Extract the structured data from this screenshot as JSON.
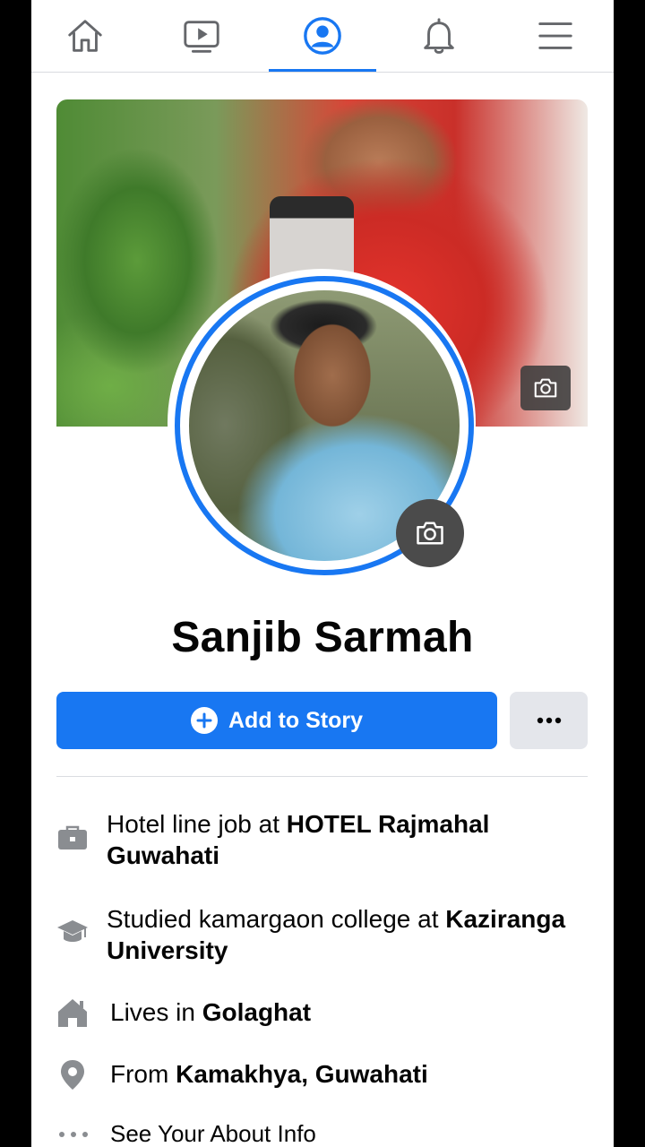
{
  "nav": {
    "tabs": [
      {
        "name": "home",
        "icon": "home-icon"
      },
      {
        "name": "watch",
        "icon": "video-icon"
      },
      {
        "name": "profile",
        "icon": "profile-icon",
        "active": true
      },
      {
        "name": "notifications",
        "icon": "bell-icon"
      },
      {
        "name": "menu",
        "icon": "hamburger-menu-icon"
      }
    ],
    "accent_color": "#1877f2"
  },
  "profile": {
    "name": "Sanjib Sarmah"
  },
  "actions": {
    "add_story_label": "Add to Story",
    "more_label": "•••"
  },
  "details": {
    "work_prefix": "Hotel line job at ",
    "work_place": "HOTEL Rajmahal Guwahati",
    "education_prefix": "Studied kamargaon college at ",
    "education_place": "Kaziranga University",
    "lives_prefix": "Lives in ",
    "lives_place": "Golaghat",
    "from_prefix": "From ",
    "from_place": "Kamakhya, Guwahati",
    "see_about": "See Your About Info"
  }
}
